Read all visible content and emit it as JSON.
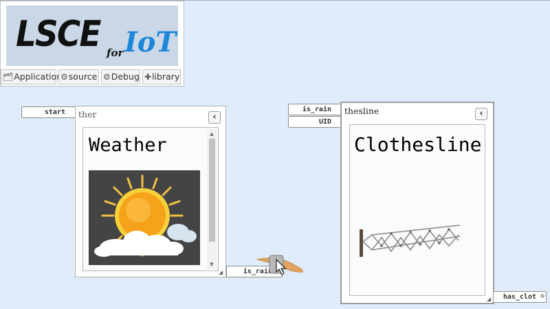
{
  "logo": {
    "main": "LSCE",
    "for": "for",
    "iot": "IoT"
  },
  "toolbar": {
    "items": [
      {
        "label": "Application",
        "icon": "folder-open-icon"
      },
      {
        "label": "source",
        "icon": "gear-icon"
      },
      {
        "label": "Debug",
        "icon": "gear-icon"
      },
      {
        "label": "library",
        "icon": "plus-icon"
      }
    ]
  },
  "weather": {
    "title": "ther",
    "heading": "Weather",
    "in_port": "start",
    "out_port": "is_rain"
  },
  "clothesline": {
    "title": "thesline",
    "heading": "Clothesline",
    "in_ports": [
      "is_rain",
      "UID"
    ],
    "out_port": "has_clot"
  },
  "colors": {
    "background": "#dfecf9",
    "iot_blue": "#1c86d8",
    "sun": "#f7a21b",
    "wire": "#e0a460"
  }
}
